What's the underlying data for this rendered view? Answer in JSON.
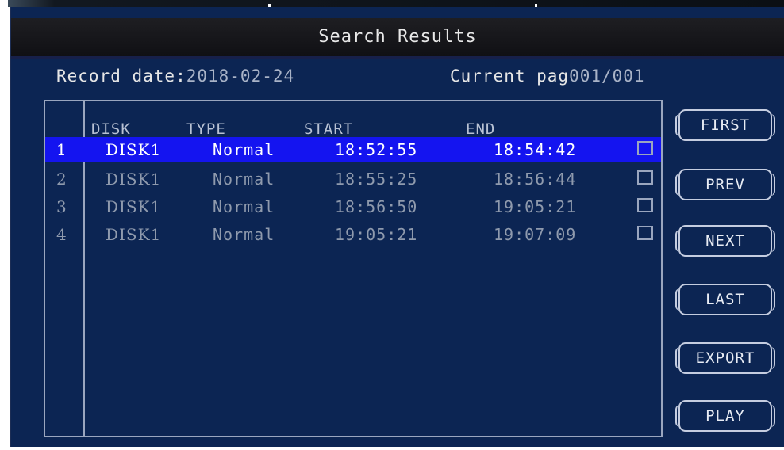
{
  "window": {
    "title": "Search Results"
  },
  "info": {
    "record_date_label": "Record date:",
    "record_date_value": "2018-02-24",
    "current_page_label": "Current pag",
    "current_page_value": "001/001"
  },
  "table": {
    "columns": [
      "DISK",
      "TYPE",
      "START",
      "END"
    ],
    "rows": [
      {
        "num": "1",
        "disk": "DISK1",
        "type": "Normal",
        "start": "18:52:55",
        "end": "18:54:42",
        "selected": true
      },
      {
        "num": "2",
        "disk": "DISK1",
        "type": "Normal",
        "start": "18:55:25",
        "end": "18:56:44",
        "selected": false
      },
      {
        "num": "3",
        "disk": "DISK1",
        "type": "Normal",
        "start": "18:56:50",
        "end": "19:05:21",
        "selected": false
      },
      {
        "num": "4",
        "disk": "DISK1",
        "type": "Normal",
        "start": "19:05:21",
        "end": "19:07:09",
        "selected": false
      }
    ]
  },
  "buttons": {
    "first": "FIRST",
    "prev": "PREV",
    "next": "NEXT",
    "last": "LAST",
    "export": "EXPORT",
    "play": "PLAY"
  },
  "colors": {
    "background": "#0c2553",
    "selection": "#1414f0",
    "border": "#9aa6bf"
  }
}
